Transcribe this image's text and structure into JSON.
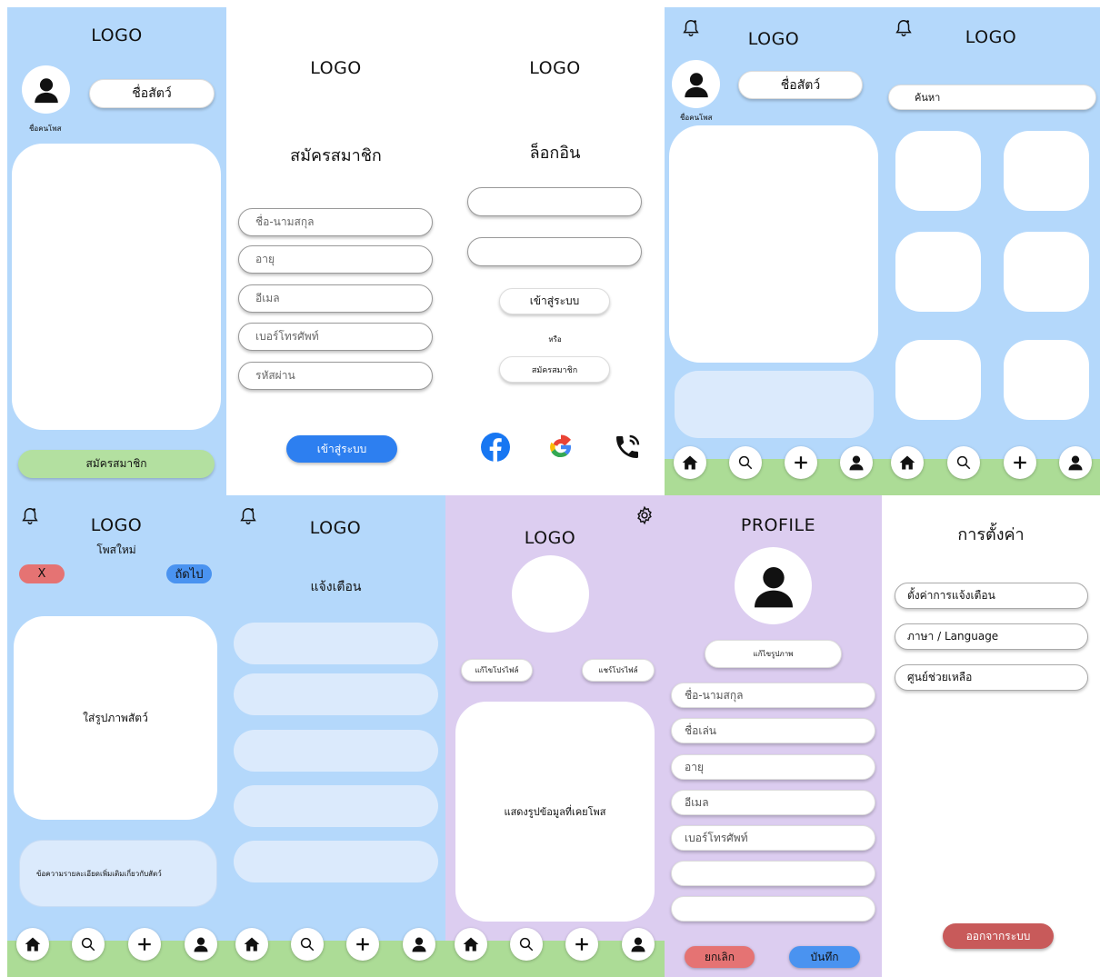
{
  "common": {
    "logo": "LOGO"
  },
  "p1": {
    "pet_name": "ชื่อสัตว์",
    "owner": "ชื่อคนโพส",
    "signup": "สมัครสมาชิก"
  },
  "p2": {
    "title": "สมัครสมาชิก",
    "fields": [
      "ชื่อ-นามสกุล",
      "อายุ",
      "อีเมล",
      "เบอร์โทรศัพท์",
      "รหัสผ่าน"
    ],
    "submit": "เข้าสู่ระบบ"
  },
  "p3": {
    "title": "ล็อกอิน",
    "login": "เข้าสู่ระบบ",
    "or": "หรือ",
    "signup": "สมัครสมาชิก"
  },
  "p4": {
    "pet_name": "ชื่อสัตว์",
    "owner": "ชื่อคนโพส"
  },
  "p5": {
    "search_placeholder": "ค้นหา"
  },
  "p6": {
    "subtitle": "โพสใหม่",
    "cancel": "X",
    "next": "ถัดไป",
    "photo": "ใส่รูปภาพสัตว์",
    "detail": "ข้อความรายละเอียดเพิ่มเติมเกี่ยวกับสัตว์"
  },
  "p7": {
    "title": "แจ้งเตือน"
  },
  "p8": {
    "edit": "แก้ไขโปรไฟล์",
    "share": "แชร์โปรไฟล์",
    "posts": "แสดงรูปข้อมูลที่เคยโพส"
  },
  "p9": {
    "title": "PROFILE",
    "edit_photo": "แก้ไขรูปภาพ",
    "fields": [
      "ชื่อ-นามสกุล",
      "ชื่อเล่น",
      "อายุ",
      "อีเมล",
      "เบอร์โทรศัพท์",
      "",
      ""
    ],
    "cancel": "ยกเลิก",
    "save": "บันทึก"
  },
  "p10": {
    "title": "การตั้งค่า",
    "items": [
      "ตั้งค่าการแจ้งเตือน",
      "ภาษา / Language",
      "ศูนย์ช่วยเหลือ"
    ],
    "logout": "ออกจากระบบ"
  },
  "colors": {
    "blue": "#b4d8fb",
    "purple": "#dccdf0",
    "green": "#acdc96",
    "accent": "#2d7ff0",
    "red": "#e57373",
    "logout": "#c85a5a"
  }
}
